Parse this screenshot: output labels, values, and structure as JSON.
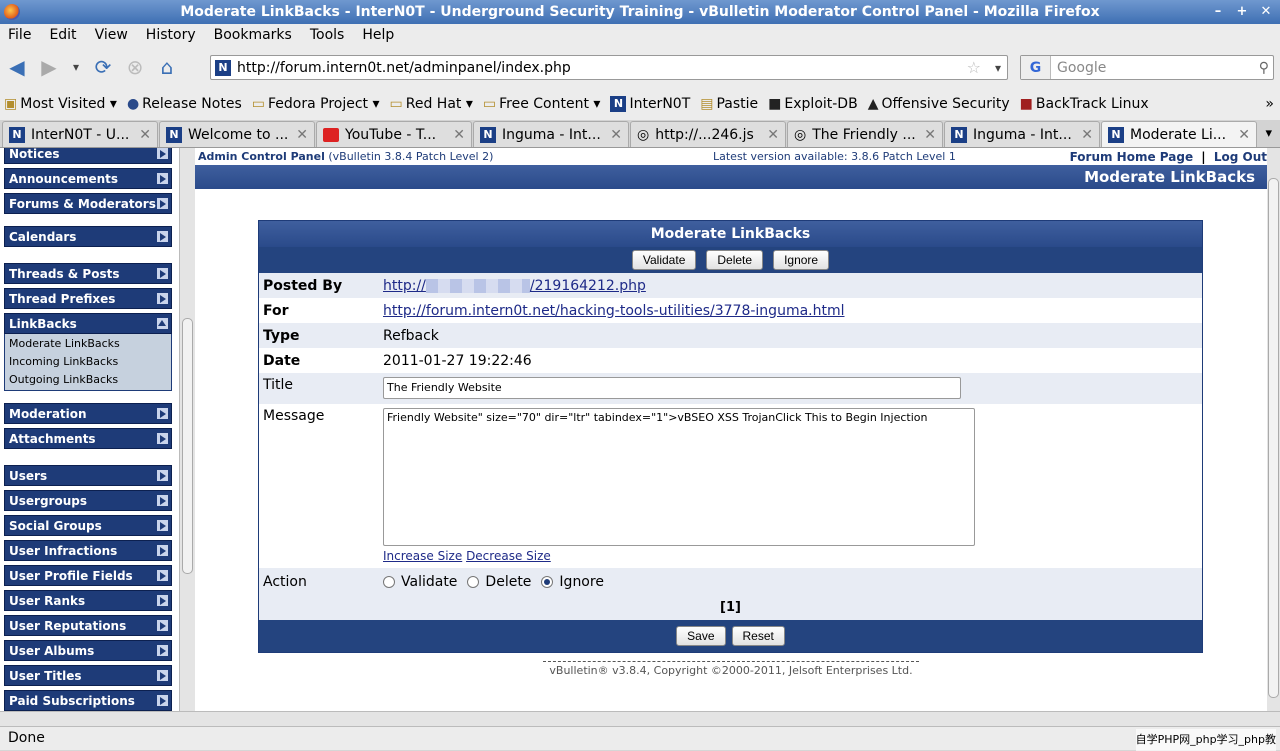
{
  "window": {
    "title": "Moderate LinkBacks - InterN0T - Underground Security Training - vBulletin Moderator Control Panel - Mozilla Firefox"
  },
  "menu": [
    "File",
    "Edit",
    "View",
    "History",
    "Bookmarks",
    "Tools",
    "Help"
  ],
  "nav": {
    "url": "http://forum.intern0t.net/adminpanel/index.php",
    "search_placeholder": "Google"
  },
  "bookmarks": [
    "Most Visited",
    "Release Notes",
    "Fedora Project",
    "Red Hat",
    "Free Content",
    "InterN0T",
    "Pastie",
    "Exploit-DB",
    "Offensive Security",
    "BackTrack Linux"
  ],
  "tabs": [
    "InterN0T - U...",
    "Welcome to ...",
    "YouTube - T...",
    "Inguma - Int...",
    "http://...246.js",
    "The Friendly ...",
    "Inguma - Int...",
    "Moderate Li..."
  ],
  "sidebar": {
    "items": [
      "Notices",
      "Announcements",
      "Forums & Moderators",
      "Calendars",
      "Threads & Posts",
      "Thread Prefixes",
      "LinkBacks",
      "Moderation",
      "Attachments",
      "Users",
      "Usergroups",
      "Social Groups",
      "User Infractions",
      "User Profile Fields",
      "User Ranks",
      "User Reputations",
      "User Albums",
      "User Titles",
      "Paid Subscriptions"
    ],
    "linkbacks_sub": [
      "Moderate LinkBacks",
      "Incoming LinkBacks",
      "Outgoing LinkBacks"
    ]
  },
  "top": {
    "admin_cp": "Admin Control Panel",
    "version": "(vBulletin 3.8.4 Patch Level 2)",
    "latest": "Latest version available: 3.8.6 Patch Level 1",
    "home": "Forum Home Page",
    "sep": "|",
    "logout": "Log Out",
    "page_title": "Moderate LinkBacks"
  },
  "panel": {
    "title": "Moderate LinkBacks",
    "buttons": {
      "validate": "Validate",
      "delete": "Delete",
      "ignore": "Ignore"
    },
    "posted_by_label": "Posted By",
    "posted_by_prefix": "http://",
    "posted_by_suffix": "/219164212.php",
    "for_label": "For",
    "for_value": "http://forum.intern0t.net/hacking-tools-utilities/3778-inguma.html",
    "type_label": "Type",
    "type_value": "Refback",
    "date_label": "Date",
    "date_value": "2011-01-27 19:22:46",
    "title_label": "Title",
    "title_value": "The Friendly Website",
    "message_label": "Message",
    "message_value": "Friendly Website\" size=\"70\" dir=\"ltr\" tabindex=\"1\">vBSEO XSS TrojanClick This to Begin Injection",
    "increase": "Increase Size",
    "decrease": "Decrease Size",
    "action_label": "Action",
    "action_options": [
      "Validate",
      "Delete",
      "Ignore"
    ],
    "action_selected": "Ignore",
    "pager": "[1]",
    "save": "Save",
    "reset": "Reset"
  },
  "footer": {
    "copyright": "vBulletin® v3.8.4, Copyright ©2000-2011, Jelsoft Enterprises Ltd."
  },
  "status": {
    "text": "Done",
    "watermark": "自学PHP网_php学习_php教"
  }
}
